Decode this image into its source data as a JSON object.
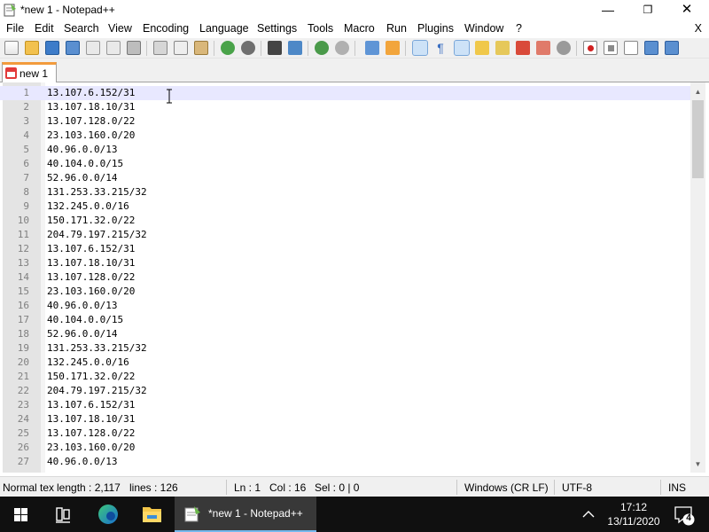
{
  "window": {
    "title": "*new 1 - Notepad++",
    "controls": {
      "minimize": "—",
      "maximize": "❐",
      "close": "✕"
    }
  },
  "menubar": {
    "items": [
      "File",
      "Edit",
      "Search",
      "View",
      "Encoding",
      "Language",
      "Settings",
      "Tools",
      "Macro",
      "Run",
      "Plugins",
      "Window",
      "?"
    ],
    "close_label": "X"
  },
  "toolbar": {
    "icons": [
      "new-file-icon",
      "open-file-icon",
      "save-icon",
      "save-all-icon",
      "close-icon",
      "close-all-icon",
      "print-icon",
      "cut-icon",
      "copy-icon",
      "paste-icon",
      "undo-icon",
      "redo-icon",
      "find-icon",
      "replace-icon",
      "zoom-in-icon",
      "zoom-out-icon",
      "sync-vertical-icon",
      "sync-horizontal-icon",
      "word-wrap-icon",
      "show-all-characters-icon",
      "indent-guide-icon",
      "user-defined-language-icon",
      "document-map-icon",
      "function-list-icon",
      "folder-as-workspace-icon",
      "monitoring-icon",
      "record-macro-icon",
      "stop-recording-icon",
      "playback-macro-icon",
      "run-macro-multiple-icon",
      "save-macro-icon"
    ]
  },
  "tabs": [
    {
      "label": "new 1",
      "icon": "unsaved-document-icon"
    }
  ],
  "editor": {
    "lines": [
      "13.107.6.152/31",
      "13.107.18.10/31",
      "13.107.128.0/22",
      "23.103.160.0/20",
      "40.96.0.0/13",
      "40.104.0.0/15",
      "52.96.0.0/14",
      "131.253.33.215/32",
      "132.245.0.0/16",
      "150.171.32.0/22",
      "204.79.197.215/32",
      "13.107.6.152/31",
      "13.107.18.10/31",
      "13.107.128.0/22",
      "23.103.160.0/20",
      "40.96.0.0/13",
      "40.104.0.0/15",
      "52.96.0.0/14",
      "131.253.33.215/32",
      "132.245.0.0/16",
      "150.171.32.0/22",
      "204.79.197.215/32",
      "13.107.6.152/31",
      "13.107.18.10/31",
      "13.107.128.0/22",
      "23.103.160.0/20",
      "40.96.0.0/13"
    ],
    "line_numbers": [
      "1",
      "2",
      "3",
      "4",
      "5",
      "6",
      "7",
      "8",
      "9",
      "10",
      "11",
      "12",
      "13",
      "14",
      "15",
      "16",
      "17",
      "18",
      "19",
      "20",
      "21",
      "22",
      "23",
      "24",
      "25",
      "26",
      "27"
    ]
  },
  "statusbar": {
    "file_type": "Normal tex",
    "length": "length : 2,117",
    "lines": "lines : 126",
    "line": "Ln : 1",
    "col": "Col : 16",
    "sel": "Sel : 0 | 0",
    "eol": "Windows (CR LF)",
    "encoding": "UTF-8",
    "mode": "INS"
  },
  "taskbar": {
    "active_app_label": "*new 1 - Notepad++",
    "time": "17:12",
    "date": "13/11/2020",
    "notification_count": "4"
  },
  "colors": {
    "current_line": "#e8e8ff",
    "tab_accent": "#f29b3c",
    "taskbar": "#101010",
    "taskbar_active_underline": "#76b9ed"
  }
}
